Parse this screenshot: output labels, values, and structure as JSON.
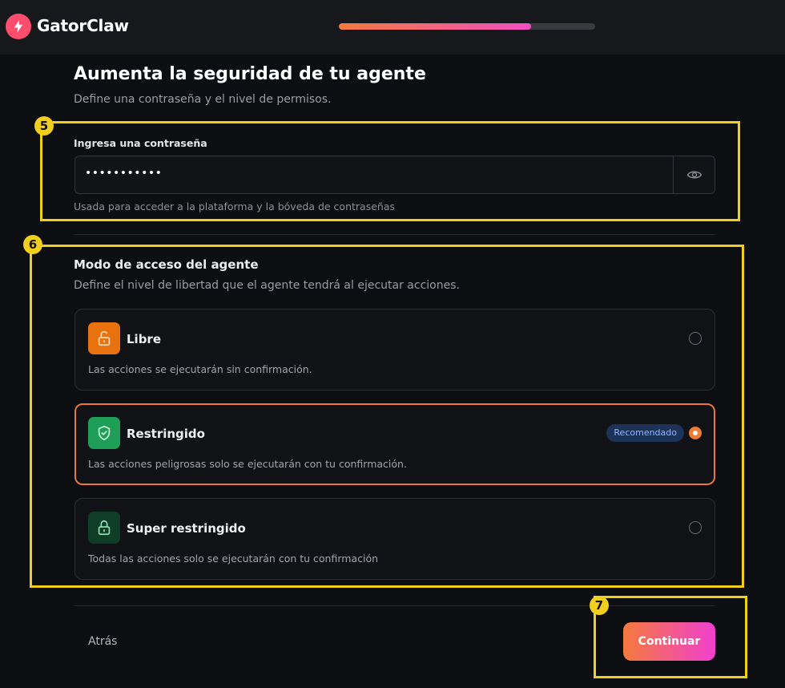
{
  "app": {
    "name": "GatorClaw"
  },
  "progress": {
    "value": 0.75
  },
  "page": {
    "title": "Aumenta la seguridad de tu agente",
    "subtitle": "Define una contraseña y el nivel de permisos."
  },
  "annotations": [
    "5",
    "6",
    "7"
  ],
  "password": {
    "label": "Ingresa una contraseña",
    "value": "•••••••••••",
    "hint": "Usada para acceder a la plataforma y la bóveda de contraseñas"
  },
  "access": {
    "title": "Modo de acceso del agente",
    "subtitle": "Define el nivel de libertad que el agente tendrá al ejecutar acciones.",
    "options": [
      {
        "title": "Libre",
        "description": "Las acciones se ejecutarán sin confirmación.",
        "icon": "unlock-icon",
        "color": "#e8730e",
        "selected": false
      },
      {
        "title": "Restringido",
        "description": "Las acciones peligrosas solo se ejecutarán con tu confirmación.",
        "badge": "Recomendado",
        "icon": "shield-check-icon",
        "color": "#1f9e58",
        "selected": true
      },
      {
        "title": "Super restringido",
        "description": "Todas las acciones solo se ejecutarán con tu confirmación",
        "icon": "lock-icon",
        "color": "#0f3d25",
        "selected": false
      }
    ]
  },
  "footer": {
    "back_label": "Atrás",
    "continue_label": "Continuar"
  },
  "colors": {
    "accent_start": "#f47a3c",
    "accent_end": "#f23fd0",
    "highlight": "#f2cf1d"
  }
}
